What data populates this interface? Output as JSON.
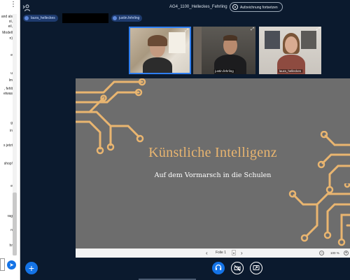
{
  "meeting": {
    "title": "AG4_1100_Helleckes_Fehrling",
    "record_label": "Aufzeichnung fortsetzen"
  },
  "participant_chips": [
    {
      "label": "laura_helleckes"
    },
    {
      "label": "justin.fehrling"
    }
  ],
  "video_tiles": [
    {
      "label": "",
      "active": true
    },
    {
      "label": "justin.fehrling",
      "active": false
    },
    {
      "label": "laura_helleckes",
      "active": false
    }
  ],
  "chat": {
    "fragments": [
      "and als",
      "ol,",
      "eil,",
      "Modell",
      "n)",
      "e",
      "u",
      "lm",
      ", fehlt",
      "etwas",
      "g",
      "in",
      "s jetzt",
      "shop!",
      "e",
      "rag",
      "n",
      "hr"
    ]
  },
  "slide": {
    "title": "Künstliche Intelligenz",
    "subtitle": "Auf dem Vormarsch in die Schulen",
    "background_color": "#6d6d6d",
    "accent_color": "#e9b570"
  },
  "slide_nav": {
    "page_label": "Folie 1",
    "zoom_label": "100 %"
  },
  "icons": {
    "user": "user-icon",
    "record": "record-icon",
    "expand": "expand-icon",
    "send": "send-icon",
    "add": "add-icon",
    "audio": "headset-icon",
    "video": "camera-off-icon",
    "share": "share-screen-icon"
  },
  "colors": {
    "app_background": "#0b1a2e",
    "primary_blue": "#1473e6"
  }
}
